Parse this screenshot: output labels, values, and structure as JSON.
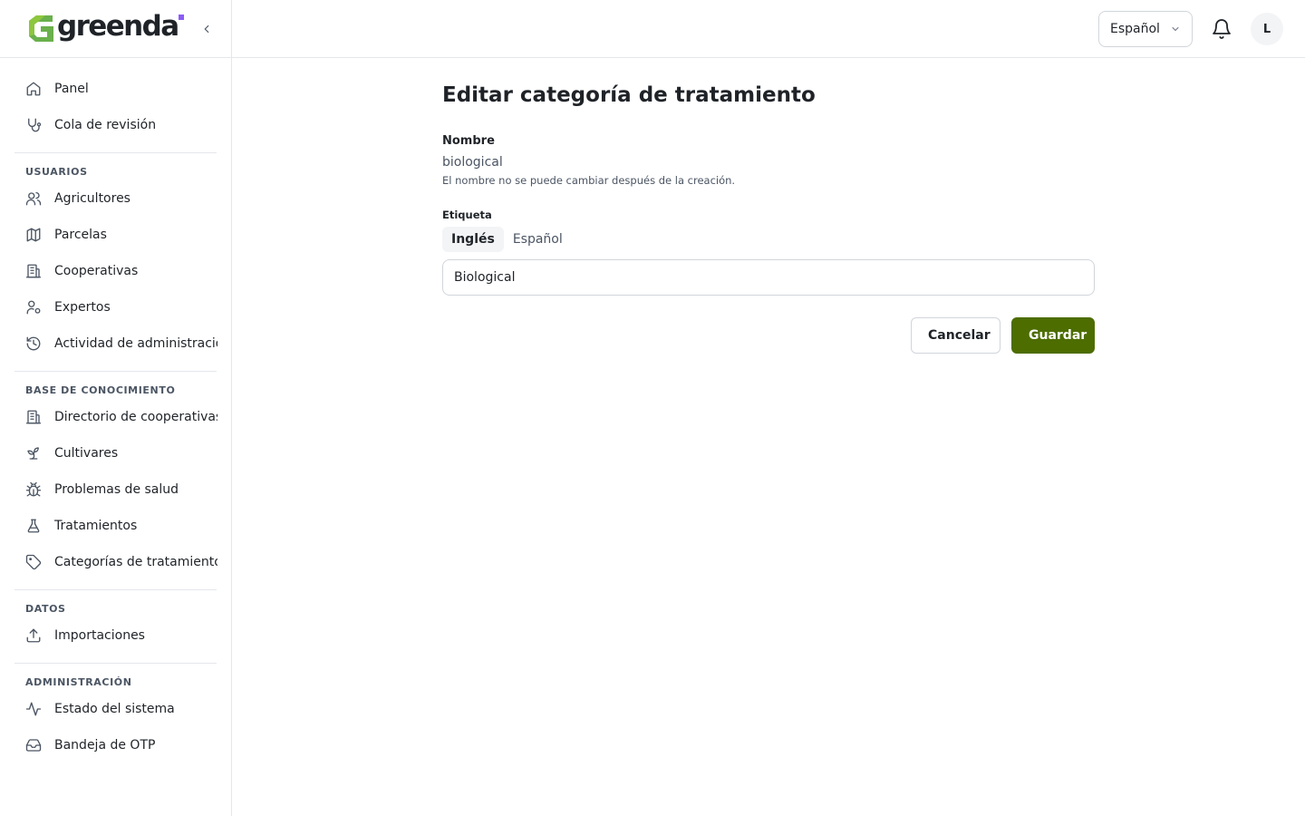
{
  "brand": {
    "name": "greenda",
    "logo_icon": "greenda-g-logo",
    "accent": "#8b5cf6",
    "primary": "#4d6d00"
  },
  "header": {
    "language": "Español",
    "avatar_initial": "L"
  },
  "sidebar": {
    "top_items": [
      {
        "label": "Panel",
        "icon": "home-icon"
      },
      {
        "label": "Cola de revisión",
        "icon": "stethoscope-icon"
      }
    ],
    "sections": [
      {
        "heading": "USUARIOS",
        "items": [
          {
            "label": "Agricultores",
            "icon": "users-icon"
          },
          {
            "label": "Parcelas",
            "icon": "map-icon"
          },
          {
            "label": "Cooperativas",
            "icon": "building-icon"
          },
          {
            "label": "Expertos",
            "icon": "user-cog-icon"
          },
          {
            "label": "Actividad de administración",
            "icon": "history-icon"
          }
        ]
      },
      {
        "heading": "BASE DE CONOCIMIENTO",
        "items": [
          {
            "label": "Directorio de cooperativas",
            "icon": "building-icon"
          },
          {
            "label": "Cultivares",
            "icon": "sprout-icon"
          },
          {
            "label": "Problemas de salud",
            "icon": "bug-icon"
          },
          {
            "label": "Tratamientos",
            "icon": "flask-icon"
          },
          {
            "label": "Categorías de tratamiento",
            "icon": "tag-icon"
          }
        ]
      },
      {
        "heading": "DATOS",
        "items": [
          {
            "label": "Importaciones",
            "icon": "upload-icon"
          }
        ]
      },
      {
        "heading": "ADMINISTRACIÓN",
        "items": [
          {
            "label": "Estado del sistema",
            "icon": "activity-icon"
          },
          {
            "label": "Bandeja de OTP",
            "icon": "inbox-icon"
          }
        ]
      }
    ]
  },
  "main": {
    "title": "Editar categoría de tratamiento",
    "name_label": "Nombre",
    "name_value": "biological",
    "name_help": "El nombre no se puede cambiar después de la creación.",
    "label_title": "Etiqueta",
    "tabs": [
      {
        "label": "Inglés",
        "active": true
      },
      {
        "label": "Español",
        "active": false
      }
    ],
    "label_value": "Biological",
    "cancel_label": "Cancelar",
    "save_label": "Guardar"
  }
}
